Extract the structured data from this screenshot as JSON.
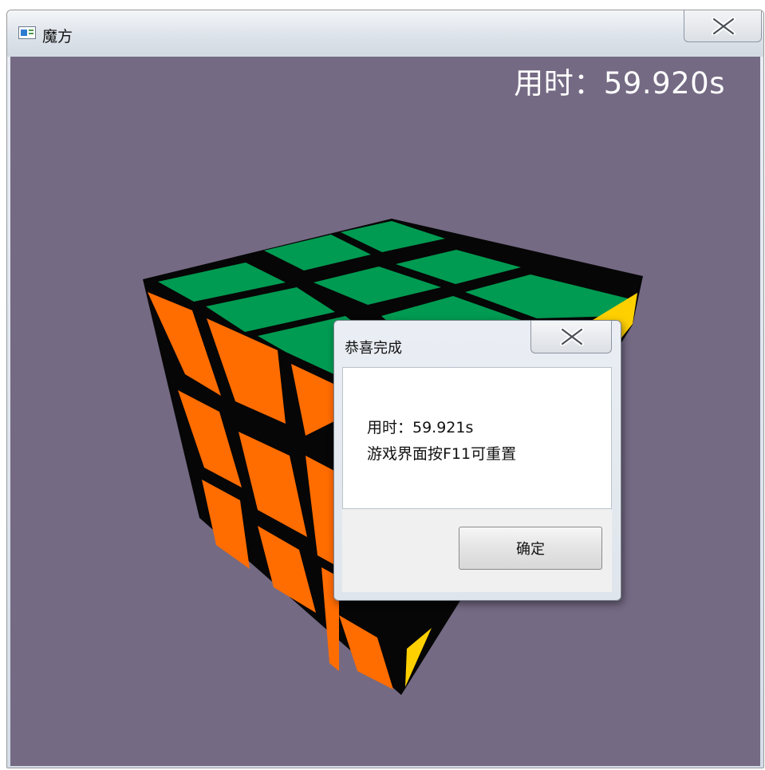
{
  "window": {
    "title": "魔方",
    "close_icon": "close-x-icon",
    "app_icon": "app-window-icon"
  },
  "game": {
    "timer_text": "用时：59.920s",
    "background_color": "#756a84",
    "cube": {
      "faces_visible": [
        "top",
        "front-left",
        "right"
      ],
      "colors": {
        "top": "#009b52",
        "front_left": "#ff6c00",
        "right": "#ffd000",
        "edges": "#050505"
      }
    }
  },
  "dialog": {
    "title": "恭喜完成",
    "close_icon": "close-x-icon",
    "message_line1": "用时：59.921s",
    "message_line2": "游戏界面按F11可重置",
    "ok_label": "确定"
  }
}
